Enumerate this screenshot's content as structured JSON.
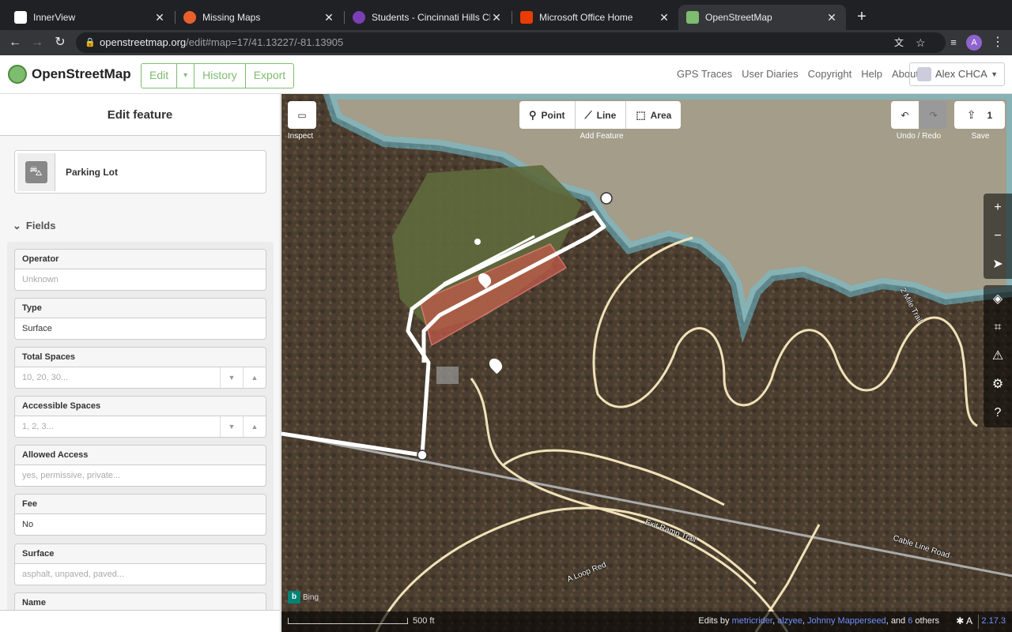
{
  "browser": {
    "tabs": [
      {
        "title": "InnerView",
        "color": "#ffffff"
      },
      {
        "title": "Missing Maps",
        "color": "#e8612c"
      },
      {
        "title": "Students - Cincinnati Hills Chri",
        "color": "#7b3fb5"
      },
      {
        "title": "Microsoft Office Home",
        "color": "#eb3c00"
      },
      {
        "title": "OpenStreetMap",
        "color": "#7ebc6f"
      }
    ],
    "url_host": "openstreetmap.org",
    "url_path": "/edit#map=17/41.13227/-81.13905",
    "profile_initial": "A"
  },
  "header": {
    "site_name": "OpenStreetMap",
    "edit_label": "Edit",
    "history_label": "History",
    "export_label": "Export",
    "links": [
      "GPS Traces",
      "User Diaries",
      "Copyright",
      "Help",
      "About"
    ],
    "user_name": "Alex CHCA"
  },
  "sidebar": {
    "title": "Edit feature",
    "preset_name": "Parking Lot",
    "fields_heading": "Fields",
    "fields": [
      {
        "label": "Operator",
        "value": "Unknown",
        "placeholder": true,
        "spin": false
      },
      {
        "label": "Type",
        "value": "Surface",
        "placeholder": false,
        "spin": false
      },
      {
        "label": "Total Spaces",
        "value": "10, 20, 30...",
        "placeholder": true,
        "spin": true
      },
      {
        "label": "Accessible Spaces",
        "value": "1, 2, 3...",
        "placeholder": true,
        "spin": true
      },
      {
        "label": "Allowed Access",
        "value": "yes, permissive, private...",
        "placeholder": true,
        "spin": false
      },
      {
        "label": "Fee",
        "value": "No",
        "placeholder": false,
        "spin": false
      },
      {
        "label": "Surface",
        "value": "asphalt, unpaved, paved...",
        "placeholder": true,
        "spin": false
      },
      {
        "label": "Name",
        "value": "",
        "placeholder": false,
        "spin": false
      }
    ]
  },
  "map": {
    "inspect_label": "Inspect",
    "point_label": "Point",
    "line_label": "Line",
    "area_label": "Area",
    "add_feature_label": "Add Feature",
    "undo_redo_label": "Undo / Redo",
    "save_label": "Save",
    "save_count": "1",
    "trail_labels": [
      "2 Mile Trail",
      "Exit Ramp Trail",
      "Cable Line Road",
      "A Loop Red"
    ],
    "imagery_label": "Bing",
    "scale_label": "500 ft",
    "edits_by_prefix": "Edits by",
    "editors": [
      "metricrider",
      "alzyee",
      "Johnny Mapperseed"
    ],
    "and_label": "and",
    "others_count": "6",
    "others_label": "others",
    "version": "2.17.3"
  }
}
